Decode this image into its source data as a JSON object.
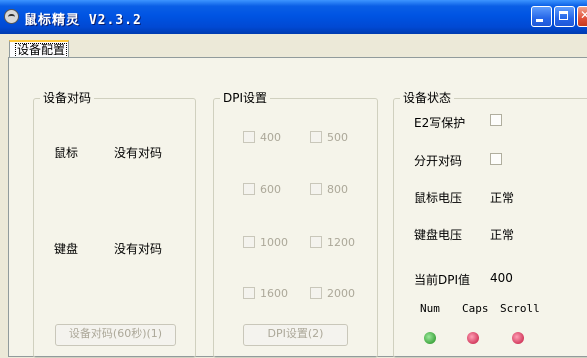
{
  "window": {
    "title": "鼠标精灵 V2.3.2"
  },
  "tabs": [
    {
      "label": "设备配置"
    }
  ],
  "pairing": {
    "title": "设备对码",
    "rows": [
      {
        "device": "鼠标",
        "status": "没有对码"
      },
      {
        "device": "键盘",
        "status": "没有对码"
      }
    ],
    "button_label": "设备对码(60秒)(1)"
  },
  "dpi": {
    "title": "DPI设置",
    "options": [
      {
        "label": "400",
        "checked": false
      },
      {
        "label": "500",
        "checked": false
      },
      {
        "label": "600",
        "checked": false
      },
      {
        "label": "800",
        "checked": false
      },
      {
        "label": "1000",
        "checked": false
      },
      {
        "label": "1200",
        "checked": false
      },
      {
        "label": "1600",
        "checked": false
      },
      {
        "label": "2000",
        "checked": false
      }
    ],
    "button_label": "DPI设置(2)"
  },
  "status": {
    "title": "设备状态",
    "e2_protect_label": "E2写保护",
    "separate_pairing_label": "分开对码",
    "mouse_voltage_label": "鼠标电压",
    "mouse_voltage_value": "正常",
    "keyboard_voltage_label": "键盘电压",
    "keyboard_voltage_value": "正常",
    "current_dpi_label": "当前DPI值",
    "current_dpi_value": "400",
    "leds": [
      {
        "label": "Num",
        "color": "#1a8a1a"
      },
      {
        "label": "Caps",
        "color": "#c0123b"
      },
      {
        "label": "Scroll",
        "color": "#c0123b"
      }
    ]
  }
}
